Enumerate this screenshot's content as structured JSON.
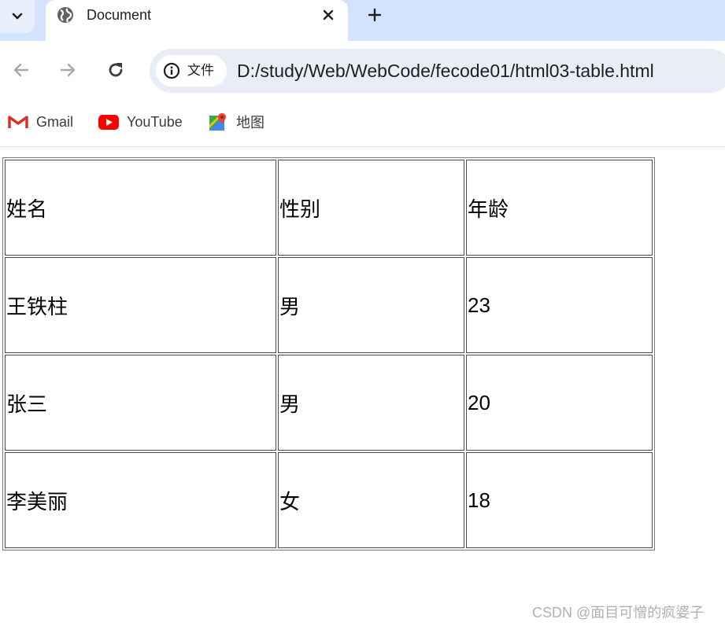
{
  "browser": {
    "tab": {
      "title": "Document",
      "favicon": "globe-icon",
      "close_icon": "close-icon"
    },
    "tab_menu_icon": "chevron-down-icon",
    "new_tab_icon": "plus-icon",
    "nav": {
      "back_icon": "arrow-left-icon",
      "forward_icon": "arrow-right-icon",
      "reload_icon": "reload-icon"
    },
    "omnibox": {
      "chip_label": "文件",
      "chip_icon": "info-icon",
      "url": "D:/study/Web/WebCode/fecode01/html03-table.html"
    },
    "bookmarks": [
      {
        "label": "Gmail",
        "icon": "gmail-icon"
      },
      {
        "label": "YouTube",
        "icon": "youtube-icon"
      },
      {
        "label": "地图",
        "icon": "maps-icon"
      }
    ]
  },
  "table": {
    "rows": [
      [
        "姓名",
        "性别",
        "年龄"
      ],
      [
        "王铁柱",
        "男",
        "23"
      ],
      [
        "张三",
        "男",
        "20"
      ],
      [
        "李美丽",
        "女",
        "18"
      ]
    ]
  },
  "watermark": "CSDN @面目可憎的疯婆子",
  "colors": {
    "tabstrip": "#d3e3fd",
    "omnibox": "#e9eef6",
    "youtube_red": "#ff0000"
  }
}
